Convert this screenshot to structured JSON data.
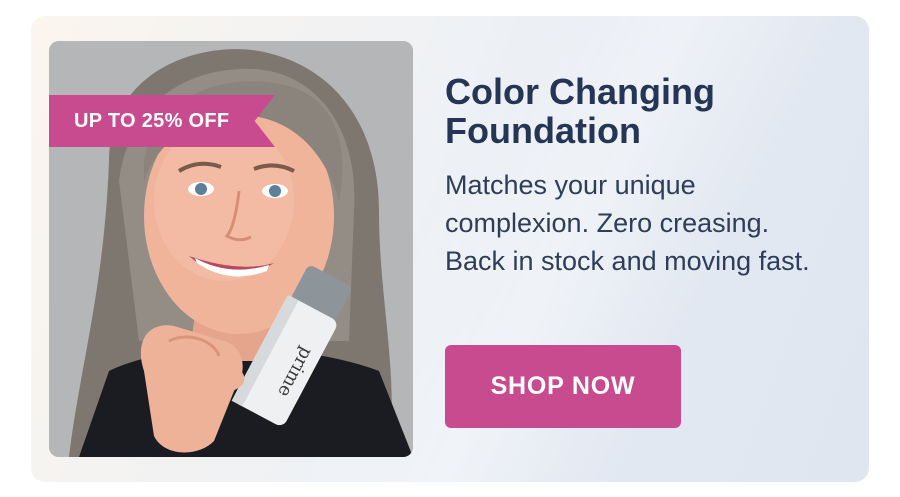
{
  "promo": {
    "badge": "UP TO 25% OFF",
    "title": "Color Changing Foundation",
    "description": "Matches your unique complexion. Zero creasing. Back in stock and moving fast.",
    "cta_label": "SHOP NOW",
    "product_label": "prime"
  },
  "colors": {
    "accent": "#c94b8f",
    "heading": "#243555",
    "body_text": "#2e3d58",
    "card_background": "#eef1f5"
  },
  "icons": {
    "product_photo": "woman-holding-foundation-bottle"
  }
}
